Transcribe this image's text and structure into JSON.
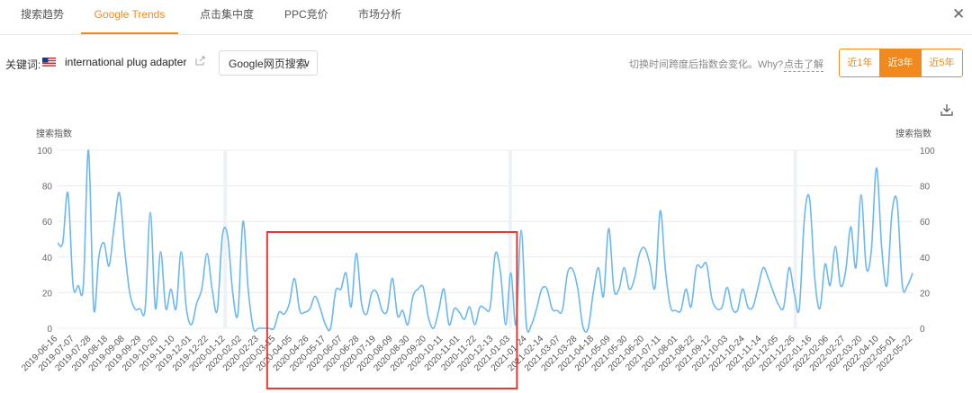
{
  "tabs": [
    {
      "label": "搜索趋势"
    },
    {
      "label": "Google Trends"
    },
    {
      "label": "点击集中度"
    },
    {
      "label": "PPC竞价"
    },
    {
      "label": "市场分析"
    }
  ],
  "active_tab": "Google Trends",
  "filter": {
    "keyword_label": "关键词:",
    "keyword": "international plug adapter",
    "source_select": "Google网页搜索",
    "hint": "切换时间跨度后指数会变化。Why?",
    "hint_link": "点击了解",
    "ranges": [
      "近1年",
      "近3年",
      "近5年"
    ],
    "active_range": "近3年"
  },
  "colors": {
    "accent": "#f08a1e",
    "line": "#6bb8f0",
    "highlight_box": "#e53935"
  },
  "chart_data": {
    "type": "line",
    "ylabel_left": "搜索指数",
    "ylabel_right": "搜索指数",
    "ylim": [
      0,
      100
    ],
    "yticks": [
      0,
      20,
      40,
      60,
      80,
      100
    ],
    "grid": true,
    "x_tick_labels": [
      "2019-06-16",
      "2019-07-07",
      "2019-07-28",
      "2019-08-18",
      "2019-09-08",
      "2019-09-29",
      "2019-10-20",
      "2019-11-10",
      "2019-12-01",
      "2019-12-22",
      "2020-01-12",
      "2020-02-02",
      "2020-02-23",
      "2020-03-15",
      "2020-04-05",
      "2020-04-26",
      "2020-05-17",
      "2020-06-07",
      "2020-06-28",
      "2020-07-19",
      "2020-08-09",
      "2020-08-30",
      "2020-09-20",
      "2020-10-11",
      "2020-11-01",
      "2020-11-22",
      "2020-12-13",
      "2021-01-03",
      "2021-01-24",
      "2021-02-14",
      "2021-03-07",
      "2021-03-28",
      "2021-04-18",
      "2021-05-09",
      "2021-05-30",
      "2021-06-20",
      "2021-07-11",
      "2021-08-01",
      "2021-08-22",
      "2021-09-12",
      "2021-10-03",
      "2021-10-24",
      "2021-11-14",
      "2021-12-05",
      "2021-12-26",
      "2022-01-16",
      "2022-02-06",
      "2022-02-27",
      "2022-03-20",
      "2022-04-10",
      "2022-05-01",
      "2022-05-22"
    ],
    "series": [
      {
        "values": [
          48,
          48,
          76,
          24,
          24,
          24,
          100,
          11,
          40,
          48,
          35,
          58,
          76,
          45,
          20,
          11,
          11,
          11,
          65,
          11,
          43,
          11,
          22,
          11,
          43,
          11,
          2,
          14,
          22,
          42,
          22,
          10,
          52,
          52,
          20,
          8,
          60,
          22,
          0,
          0,
          0,
          0,
          0,
          9,
          8,
          14,
          28,
          10,
          9,
          11,
          18,
          11,
          2,
          0,
          21,
          22,
          31,
          12,
          42,
          14,
          8,
          20,
          20,
          10,
          10,
          28,
          7,
          10,
          2,
          18,
          22,
          23,
          6,
          0,
          10,
          22,
          2,
          11,
          9,
          5,
          12,
          2,
          12,
          11,
          12,
          42,
          31,
          2,
          31,
          2,
          55,
          2,
          2,
          11,
          22,
          22,
          11,
          10,
          10,
          31,
          33,
          22,
          1,
          0,
          20,
          34,
          18,
          56,
          22,
          22,
          34,
          22,
          28,
          42,
          45,
          36,
          23,
          66,
          33,
          12,
          10,
          10,
          22,
          12,
          34,
          34,
          36,
          17,
          11,
          12,
          23,
          11,
          10,
          22,
          12,
          12,
          23,
          34,
          28,
          20,
          13,
          12,
          34,
          20,
          11,
          62,
          73,
          28,
          11,
          36,
          24,
          46,
          24,
          32,
          57,
          34,
          75,
          34,
          44,
          90,
          45,
          24,
          65,
          71,
          24,
          24,
          31
        ]
      }
    ],
    "highlighted_range": [
      "2020-03-15",
      "2020-12-13"
    ]
  }
}
